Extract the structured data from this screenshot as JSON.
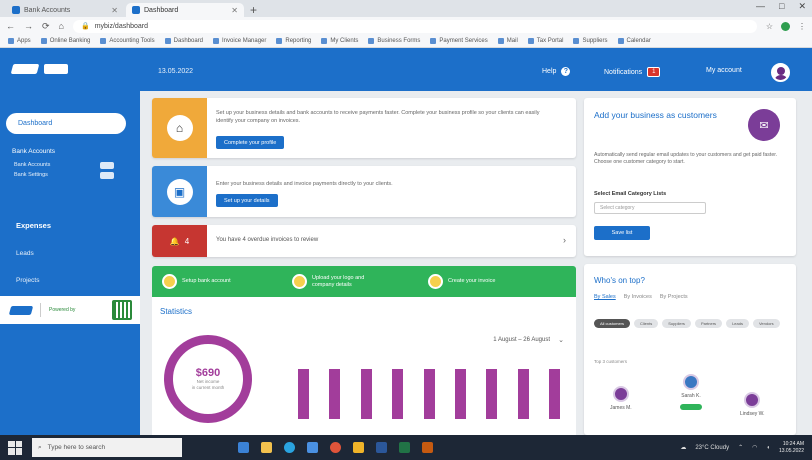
{
  "browser": {
    "tabs": [
      {
        "title": "Bank Accounts"
      },
      {
        "title": "Dashboard"
      }
    ],
    "new_tab": "+",
    "window_controls": [
      "—",
      "□",
      "✕"
    ],
    "address": {
      "url": "mybiz/dashboard",
      "nav": [
        "←",
        "→",
        "⟳",
        "⌂"
      ],
      "right_icons": [
        "☆",
        "⋮"
      ]
    },
    "bookmarks": [
      "Apps",
      "Online Banking",
      "Accounting Tools",
      "Dashboard",
      "Invoice Manager",
      "Reporting",
      "My Clients",
      "Business Forms",
      "Payment Services",
      "Mail",
      "Tax Portal",
      "Suppliers",
      "Calendar"
    ]
  },
  "header": {
    "date": "13.05.2022",
    "help_label": "Help",
    "notifications_label": "Notifications",
    "notifications_count": "1",
    "user_label": "My account"
  },
  "sidebar": {
    "active_item": "Dashboard",
    "bank_label": "Bank Accounts",
    "bank_subitems": [
      "Bank Accounts",
      "Bank Settings"
    ],
    "section_heading": "Expenses",
    "links": [
      "Leads",
      "Projects"
    ],
    "card_text": "Powered by"
  },
  "main": {
    "card1": {
      "text": "Set up your business details and bank accounts to receive payments faster. Complete your business profile so your clients can easily identify your company on invoices.",
      "button": "Complete your profile"
    },
    "card2": {
      "text": "Enter your business details and invoice payments directly to your clients.",
      "button": "Set up your details"
    },
    "alert": {
      "count": "4",
      "text": "You have 4 overdue invoices to review"
    },
    "steps": [
      {
        "label": "Setup bank account"
      },
      {
        "label": "Upload your logo and\ncompany details"
      },
      {
        "label": "Create your invoice"
      }
    ],
    "stats": {
      "title": "Statistics",
      "range": "1 August – 26 August",
      "donut_value": "$690",
      "donut_label": "Net income\nin current month"
    }
  },
  "right": {
    "panel1": {
      "title": "Add your business as customers",
      "description": "Automatically send regular email updates to your customers and get paid faster. Choose one customer category to start.",
      "select_label": "Select Email Category Lists",
      "select_placeholder": "Select category",
      "button": "Save list"
    },
    "panel2": {
      "title": "Who's on top?",
      "tabs": [
        "By Sales",
        "By Invoices",
        "By Projects"
      ],
      "chips": [
        "All customers",
        "Clients",
        "Suppliers",
        "Partners",
        "Leads",
        "Vendors"
      ],
      "list_label": "Top 3 customers",
      "people": [
        "James M.",
        "Sarah K.",
        "Lindsey W."
      ]
    }
  },
  "taskbar": {
    "search_placeholder": "Type here to search",
    "tray": "23°C Cloudy",
    "time": "10:24 AM",
    "date": "13.05.2022"
  },
  "chart_data": {
    "type": "bar",
    "categories": [
      "",
      "",
      "",
      "",
      "",
      "",
      "",
      "",
      ""
    ],
    "values": [
      48,
      48,
      48,
      48,
      48,
      48,
      48,
      48,
      48
    ],
    "y_ticks": [
      "",
      "",
      "",
      "",
      "",
      ""
    ],
    "ylim": [
      0,
      60
    ],
    "colors": {
      "bar": "#a23d9b"
    }
  },
  "theme": {
    "primary": "#1c6fc9",
    "orange": "#f0a93a",
    "blue_ribbon": "#3a8ad8",
    "red": "#c63631",
    "green": "#2fb45a",
    "purple": "#a23d9b"
  }
}
